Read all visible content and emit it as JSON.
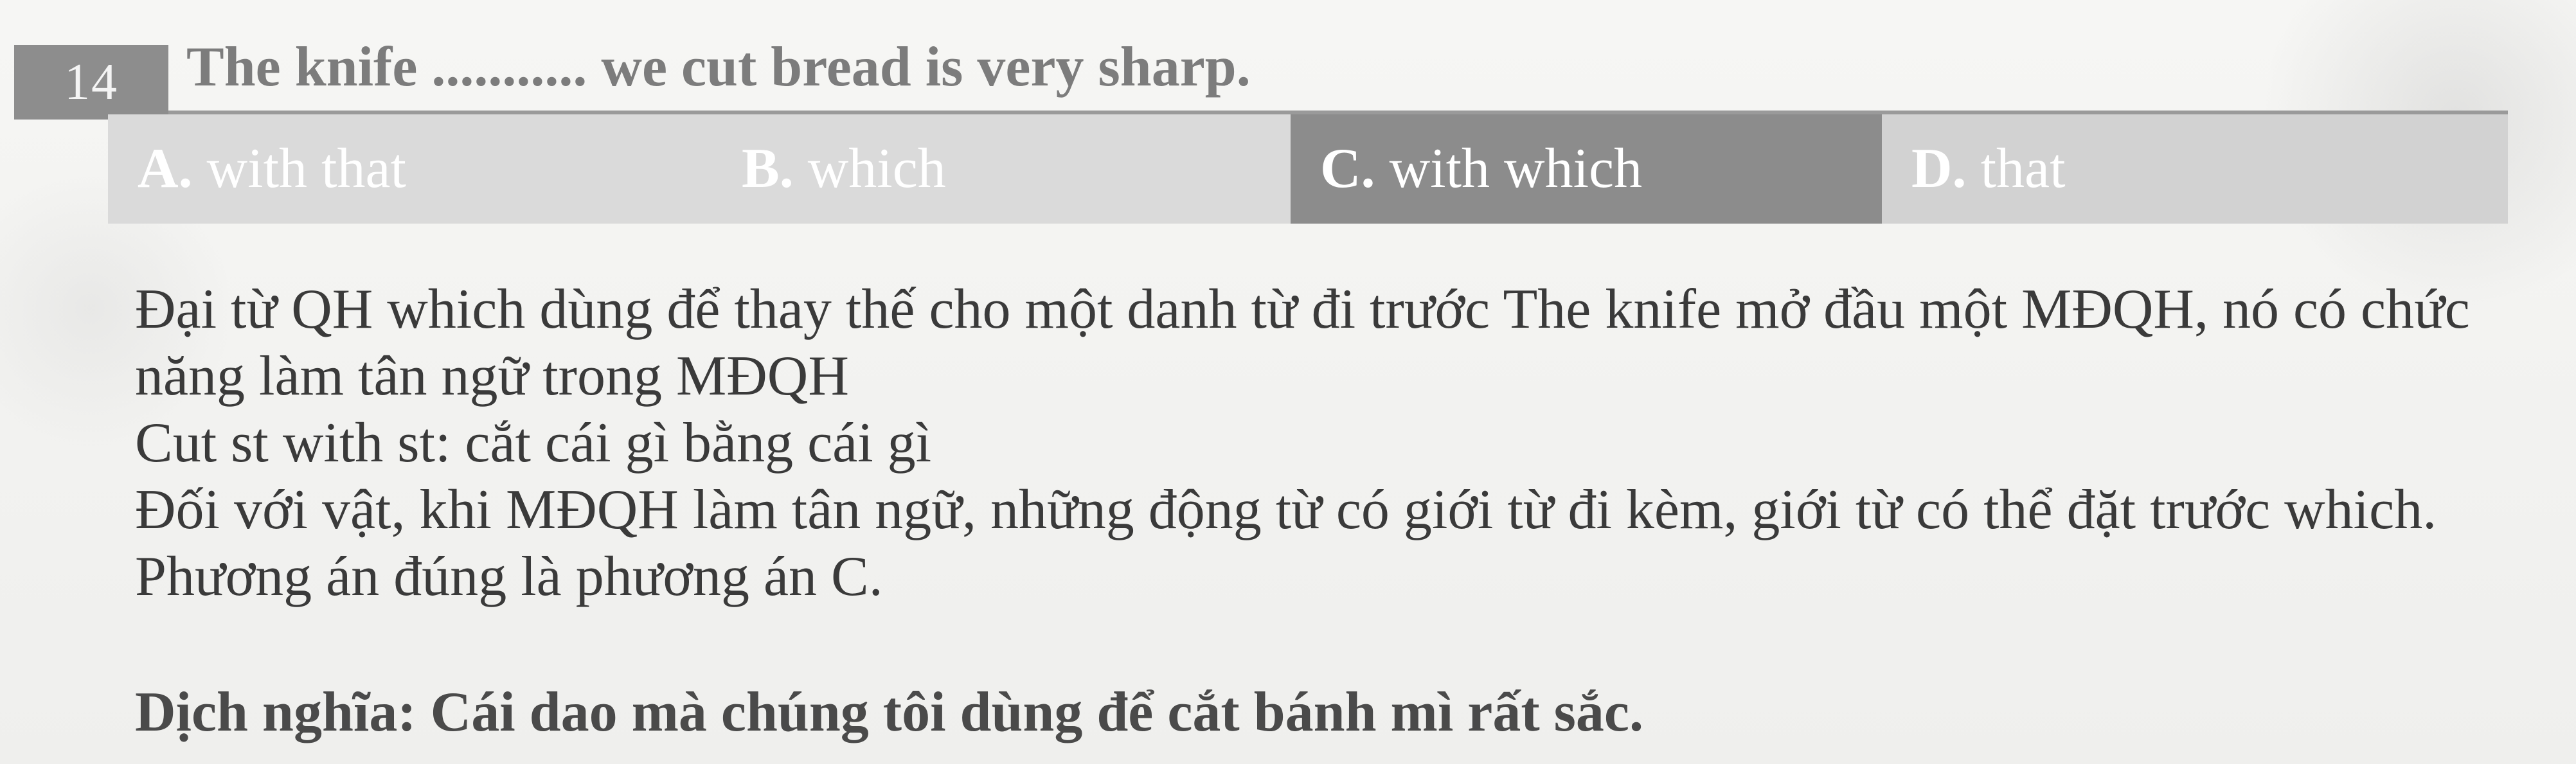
{
  "question": {
    "number": "14",
    "text": "The knife ........... we cut bread is very sharp."
  },
  "options": [
    {
      "letter": "A.",
      "text": "with that",
      "selected": false
    },
    {
      "letter": "B.",
      "text": "which",
      "selected": false
    },
    {
      "letter": "C.",
      "text": "with which",
      "selected": true
    },
    {
      "letter": "D.",
      "text": "that",
      "selected": false
    }
  ],
  "explanation": {
    "paragraph_1": "Đại từ QH which  dùng để thay thế cho một danh từ đi trước The knife mở đầu một MĐQH, nó có chức năng làm tân ngữ trong MĐQH",
    "paragraph_2": "Cut st with st: cắt cái gì bằng cái gì",
    "paragraph_3": "Đối với vật, khi MĐQH làm tân ngữ, những động từ có giới từ đi kèm, giới từ có thể đặt trước which. Phương án đúng là phương án C."
  },
  "translation": "Dịch nghĩa: Cái dao mà chúng tôi dùng để cắt bánh mì rất sắc."
}
